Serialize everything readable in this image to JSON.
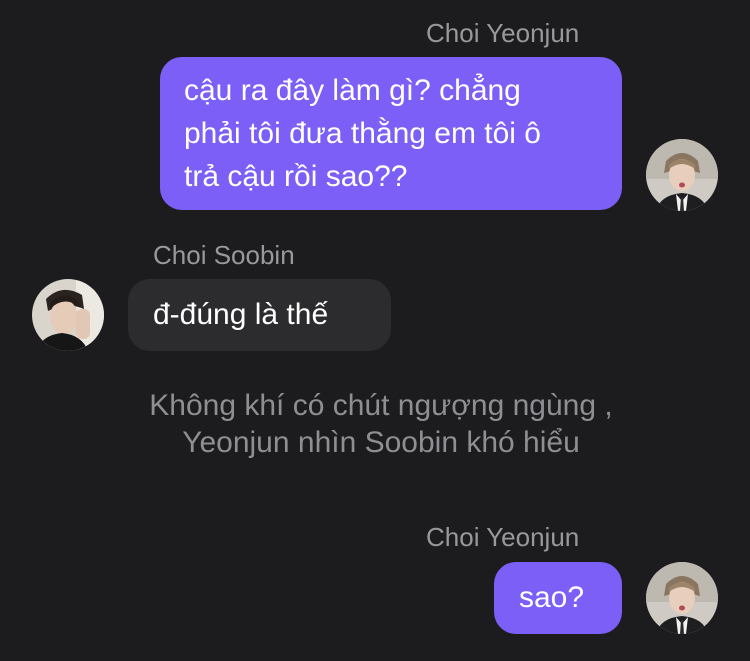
{
  "messages": [
    {
      "sender": "Choi Yeonjun",
      "lines": [
        "cậu ra đây làm gì? chẳng",
        "phải tôi đưa thằng em tôi ô",
        "trả cậu rồi sao??"
      ]
    },
    {
      "sender": "Choi Soobin",
      "lines": [
        "đ-đúng là thế"
      ]
    },
    {
      "narration": [
        "Không khí có chút ngượng ngùng ,",
        "Yeonjun nhìn Soobin khó hiểu"
      ]
    },
    {
      "sender": "Choi Yeonjun",
      "lines": [
        "sao?"
      ]
    }
  ],
  "avatars": {
    "yeonjun": "avatar-yeonjun",
    "soobin": "avatar-soobin"
  },
  "colors": {
    "background": "#1c1c1e",
    "outgoing_bubble": "#7c5ff6",
    "incoming_bubble": "#2c2c2e",
    "sender_name": "#98989d",
    "narration_text": "#8e8e93"
  }
}
